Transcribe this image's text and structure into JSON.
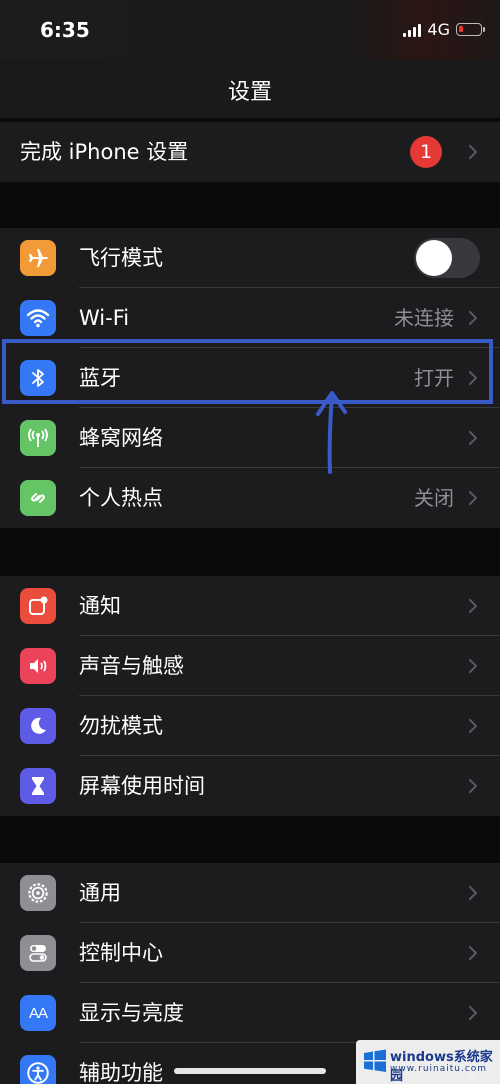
{
  "status_bar": {
    "time": "6:35",
    "network": "4G"
  },
  "nav": {
    "title": "设置"
  },
  "setup_group": {
    "label": "完成 iPhone 设置",
    "badge": "1"
  },
  "connectivity_group": [
    {
      "key": "airplane",
      "label": "飞行模式",
      "icon": "airplane-icon",
      "color": "#f19a37",
      "toggle": false
    },
    {
      "key": "wifi",
      "label": "Wi-Fi",
      "icon": "wifi-icon",
      "color": "#3478f6",
      "value": "未连接"
    },
    {
      "key": "bluetooth",
      "label": "蓝牙",
      "icon": "bluetooth-icon",
      "color": "#3478f6",
      "value": "打开"
    },
    {
      "key": "cellular",
      "label": "蜂窝网络",
      "icon": "cellular-icon",
      "color": "#65c466"
    },
    {
      "key": "hotspot",
      "label": "个人热点",
      "icon": "hotspot-icon",
      "color": "#65c466",
      "value": "关闭"
    }
  ],
  "notification_group": [
    {
      "key": "notifications",
      "label": "通知",
      "icon": "notifications-icon",
      "color": "#eb4d3d"
    },
    {
      "key": "sounds",
      "label": "声音与触感",
      "icon": "speaker-icon",
      "color": "#eb445a"
    },
    {
      "key": "dnd",
      "label": "勿扰模式",
      "icon": "moon-icon",
      "color": "#5e5ce6"
    },
    {
      "key": "screentime",
      "label": "屏幕使用时间",
      "icon": "hourglass-icon",
      "color": "#5e5ce6"
    }
  ],
  "general_group": [
    {
      "key": "general",
      "label": "通用",
      "icon": "gear-icon",
      "color": "#8e8e93"
    },
    {
      "key": "control",
      "label": "控制中心",
      "icon": "toggles-icon",
      "color": "#8e8e93"
    },
    {
      "key": "display",
      "label": "显示与亮度",
      "icon": "text-size-icon",
      "color": "#3478f6"
    },
    {
      "key": "accessibility",
      "label": "辅助功能",
      "icon": "accessibility-icon",
      "color": "#3478f6"
    }
  ],
  "watermark": {
    "title": "windows系统家园",
    "url": "www.ruinaitu.com"
  }
}
